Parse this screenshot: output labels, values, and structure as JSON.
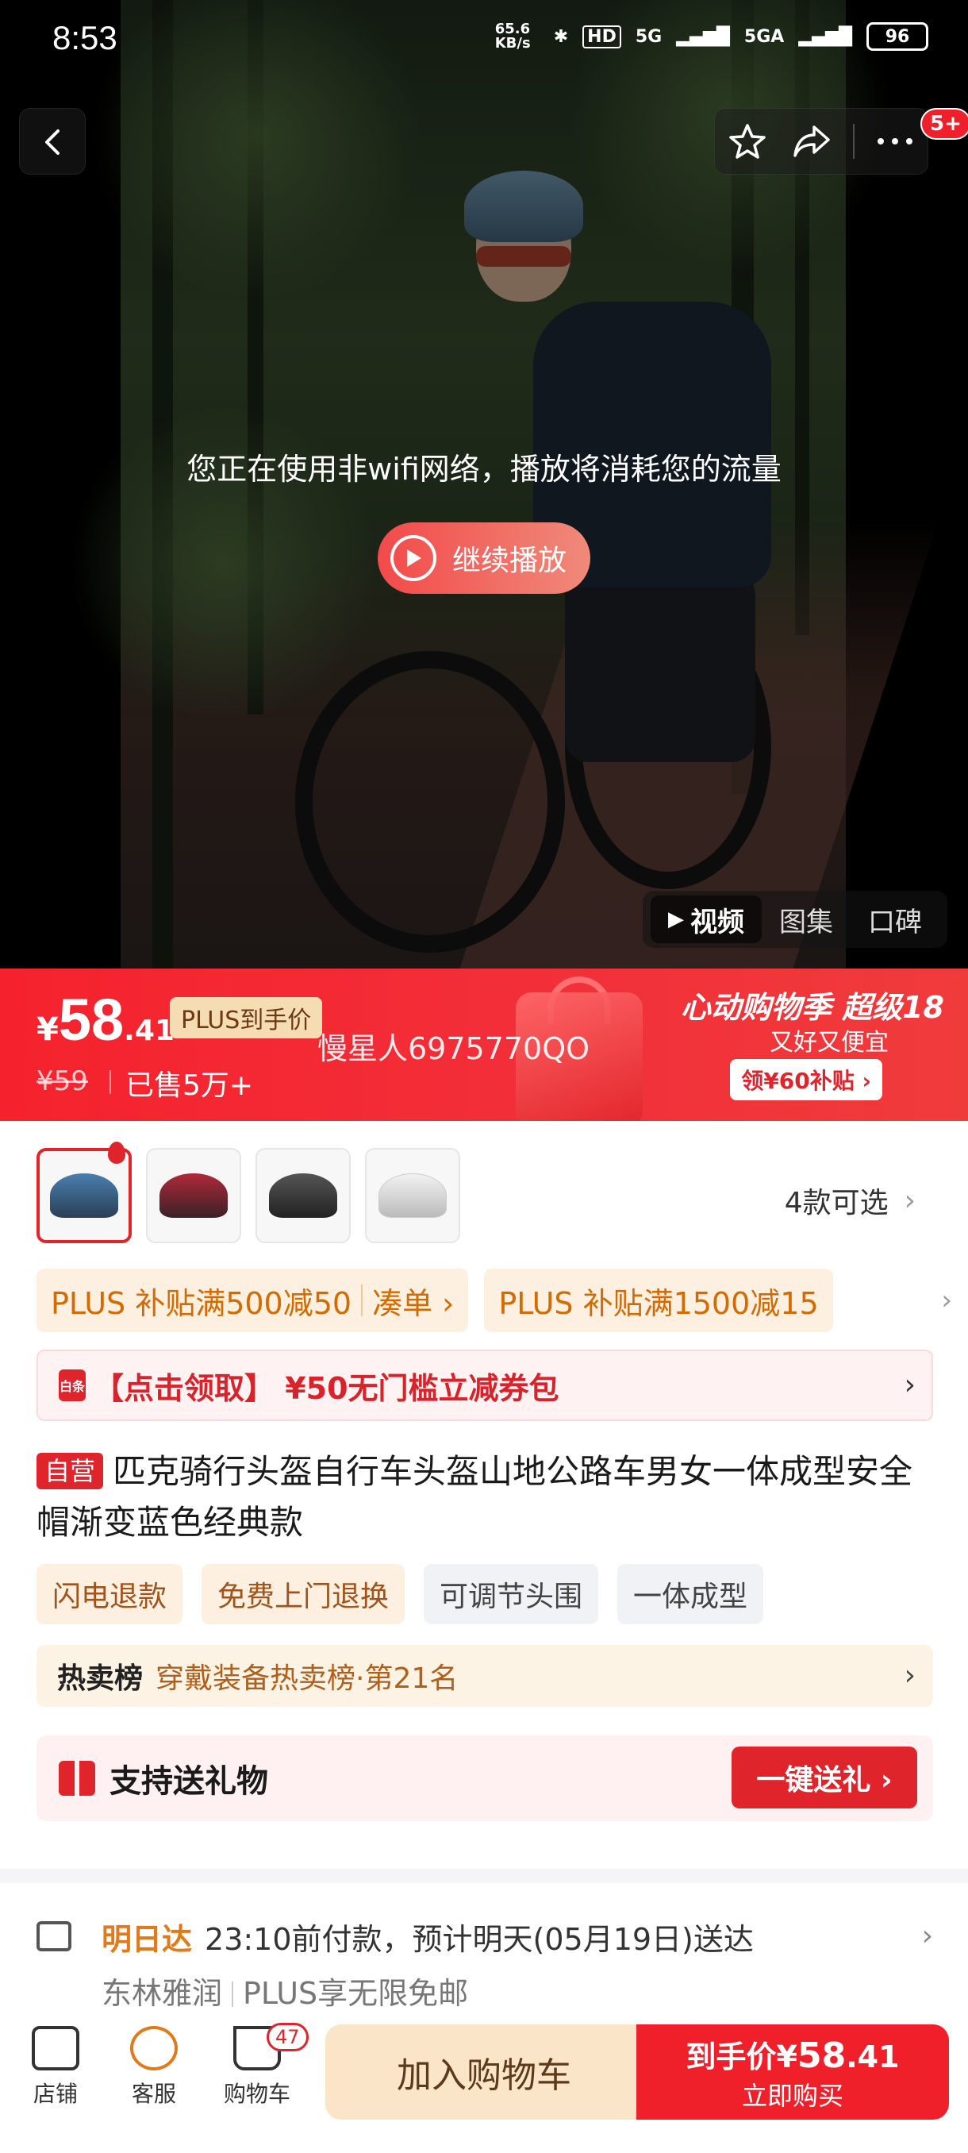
{
  "status": {
    "time": "8:53",
    "net_speed": "65.6 KB/s",
    "hd": "HD",
    "net1": "5G",
    "net2": "5GA",
    "battery": "96"
  },
  "header": {
    "badge": "5+"
  },
  "video": {
    "notice": "您正在使用非wifi网络，播放将消耗您的流量",
    "play_label": "继续播放",
    "tabs": [
      "视频",
      "图集",
      "口碑"
    ]
  },
  "price": {
    "currency": "¥",
    "integer": "58",
    "decimal": ".41",
    "plus_tag": "PLUS到手价",
    "watermark": "慢星人6975770QO",
    "original": "¥59",
    "sold": "已售5万+",
    "promo_title": "心动购物季 超级18",
    "promo_sub": "又好又便宜",
    "promo_button": "领¥60补贴 ›"
  },
  "variants": {
    "count_label": "4款可选"
  },
  "coupons": [
    {
      "left": "PLUS 补贴满500减50",
      "right": "凑单 ›"
    },
    {
      "left": "PLUS 补贴满1500减15",
      "right": ""
    }
  ],
  "coupon_pack": {
    "icon_text": "白条",
    "label": "【点击领取】 ¥50无门槛立减券包"
  },
  "title": {
    "tag": "自营",
    "text": "匹克骑行头盔自行车头盔山地公路车男女一体成型安全帽渐变蓝色经典款"
  },
  "tags": [
    "闪电退款",
    "免费上门退换",
    "可调节头围",
    "一体成型"
  ],
  "rank": {
    "hot": "热卖榜",
    "text": "穿戴装备热卖榜·第21名"
  },
  "gift": {
    "label": "支持送礼物",
    "button": "一键送礼 ›"
  },
  "delivery": {
    "fast": "明日达",
    "line1": "23:10前付款，预计明天(05月19日)送达",
    "location": "东林雅润",
    "plus": "PLUS享无限免邮"
  },
  "bottom": {
    "store": "店铺",
    "service": "客服",
    "cart": "购物车",
    "cart_count": "47",
    "add_cart": "加入购物车",
    "buy_prefix": "到手价",
    "buy_currency": "¥",
    "buy_int": "58",
    "buy_dec": ".41",
    "buy_now": "立即购买"
  },
  "colors": {
    "accent_red": "#f0202a",
    "plus_gold": "#f6dcb2",
    "coupon_orange": "#d46a00"
  }
}
